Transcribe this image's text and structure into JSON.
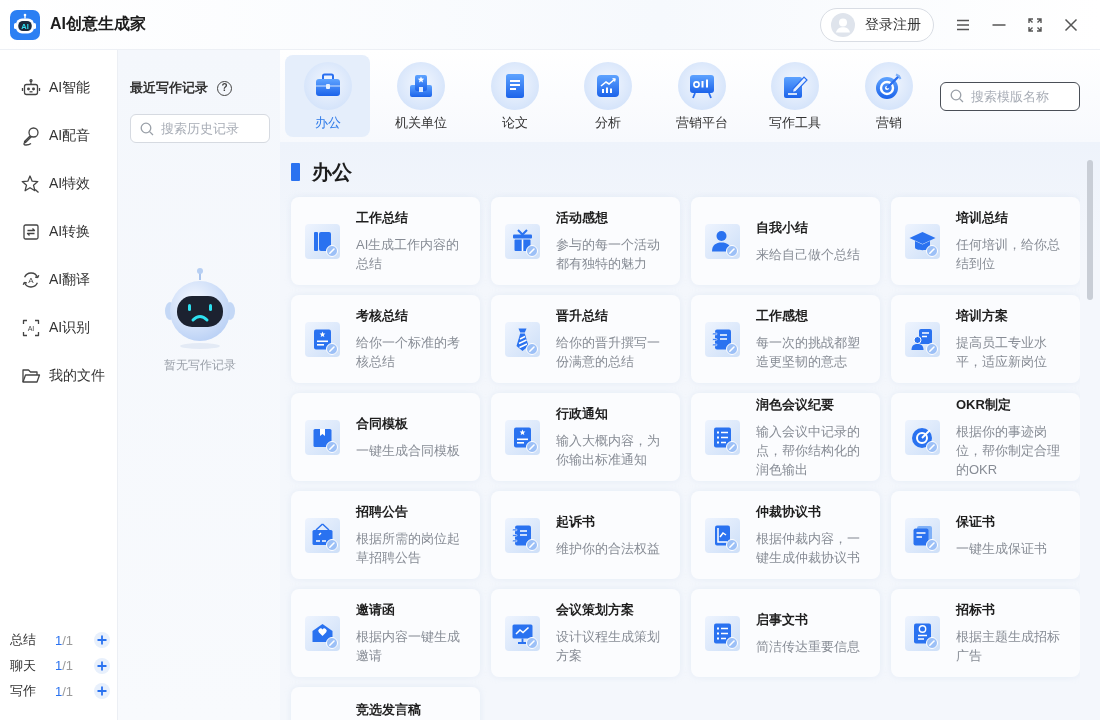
{
  "app": {
    "logo_text": "AI",
    "title": "AI创意生成家"
  },
  "account": {
    "label": "登录注册"
  },
  "nav": {
    "items": [
      {
        "label": "AI智能"
      },
      {
        "label": "AI配音"
      },
      {
        "label": "AI特效"
      },
      {
        "label": "AI转换"
      },
      {
        "label": "AI翻译",
        "icon_text": "A"
      },
      {
        "label": "AI识别",
        "icon_text": "AI"
      },
      {
        "label": "我的文件"
      }
    ],
    "quotas": [
      {
        "label": "总结",
        "used": "1",
        "total": "/1"
      },
      {
        "label": "聊天",
        "used": "1",
        "total": "/1"
      },
      {
        "label": "写作",
        "used": "1",
        "total": "/1"
      }
    ]
  },
  "history": {
    "title": "最近写作记录",
    "help": "?",
    "search": {
      "placeholder": "搜索历史记录"
    },
    "empty_text": "暂无写作记录"
  },
  "categories": [
    {
      "label": "办公",
      "selected": true
    },
    {
      "label": "机关单位",
      "selected": false
    },
    {
      "label": "论文",
      "selected": false
    },
    {
      "label": "分析",
      "selected": false
    },
    {
      "label": "营销平台",
      "selected": false
    },
    {
      "label": "写作工具",
      "selected": false
    },
    {
      "label": "营销",
      "selected": false
    }
  ],
  "template_search": {
    "placeholder": "搜索模版名称"
  },
  "section": {
    "title": "办公",
    "templates": [
      {
        "title": "工作总结",
        "description": "AI生成工作内容的总结"
      },
      {
        "title": "活动感想",
        "description": "参与的每一个活动都有独特的魅力"
      },
      {
        "title": "自我小结",
        "description": "来给自己做个总结"
      },
      {
        "title": "培训总结",
        "description": "任何培训，给你总结到位"
      },
      {
        "title": "考核总结",
        "description": "给你一个标准的考核总结"
      },
      {
        "title": "晋升总结",
        "description": "给你的晋升撰写一份满意的总结"
      },
      {
        "title": "工作感想",
        "description": "每一次的挑战都塑造更坚韧的意志"
      },
      {
        "title": "培训方案",
        "description": "提高员工专业水平，适应新岗位"
      },
      {
        "title": "合同模板",
        "description": "一键生成合同模板"
      },
      {
        "title": "行政通知",
        "description": "输入大概内容，为你输出标准通知"
      },
      {
        "title": "润色会议纪要",
        "description": "输入会议中记录的点，帮你结构化的润色输出"
      },
      {
        "title": "OKR制定",
        "description": "根据你的事迹岗位，帮你制定合理的OKR"
      },
      {
        "title": "招聘公告",
        "description": "根据所需的岗位起草招聘公告"
      },
      {
        "title": "起诉书",
        "description": "维护你的合法权益"
      },
      {
        "title": "仲裁协议书",
        "description": "根据仲裁内容，一键生成仲裁协议书"
      },
      {
        "title": "保证书",
        "description": "一键生成保证书"
      },
      {
        "title": "邀请函",
        "description": "根据内容一键生成邀请"
      },
      {
        "title": "会议策划方案",
        "description": "设计议程生成策划方案"
      },
      {
        "title": "启事文书",
        "description": "简洁传达重要信息"
      },
      {
        "title": "招标书",
        "description": "根据主题生成招标广告"
      },
      {
        "title": "竞选发言稿"
      }
    ]
  }
}
